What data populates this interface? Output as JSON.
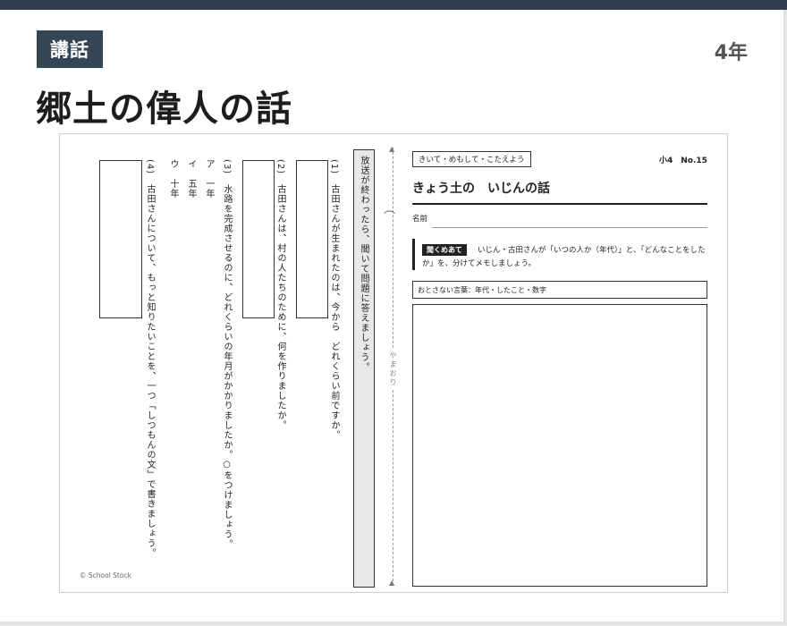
{
  "header": {
    "tag": "講話",
    "grade": "4年",
    "title": "郷土の偉人の話"
  },
  "worksheet": {
    "instruction": "放送が終わったら、聞いて問題に答えましょう。",
    "q1": "(1)　古田さんが生まれたのは、今から　どれくらい前ですか。",
    "q2": "(2)　古田さんは、村の人たちのために、何を作りましたか。",
    "q3": "(3)　水路を完成させるのに、どれくらいの年月がかかりましたか。○をつけましょう。",
    "q3_options": [
      "ア　一年",
      "イ　五年",
      "ウ　十年"
    ],
    "q4": "(4)　古田さんについて、もっと知りたいことを、一つ「しつもんの文」で書きましょう。",
    "fold_label": "やまおり",
    "copyright": "© School Stock",
    "kikite": "きいて・めもして・こたえよう",
    "number": "小4　No.15",
    "title": "きょう土の　いじんの話",
    "name_label": "名前",
    "listen_badge": "聞くめあて",
    "listen_text": "いじん・古田さんが「いつの人か（年代）」と、「どんなことをしたか」を、分けてメモしましょう。",
    "words_box": "おとさない言葉：年代・したこと・数字"
  }
}
